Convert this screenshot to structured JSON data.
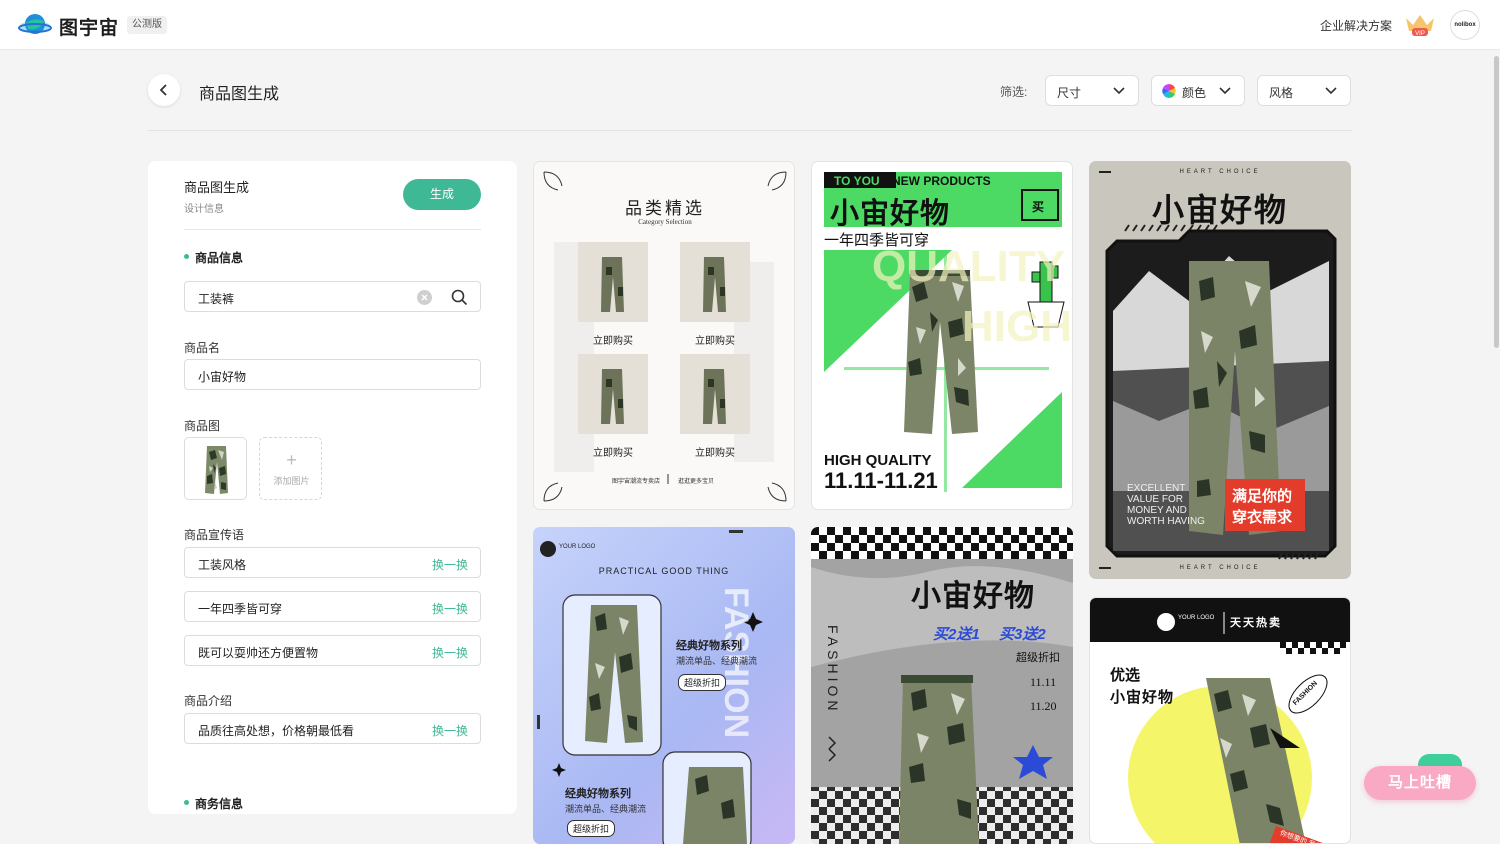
{
  "app": {
    "brand": "图宇宙",
    "badge": "公测版",
    "enterprise_link": "企业解决方案",
    "vip_label": "VIP",
    "avatar_text": "nolibox"
  },
  "header": {
    "title": "商品图生成",
    "filter_label": "筛选:",
    "filters": [
      {
        "label": "尺寸"
      },
      {
        "label": "颜色"
      },
      {
        "label": "风格"
      }
    ]
  },
  "panel": {
    "title": "商品图生成",
    "subtitle": "设计信息",
    "generate_label": "生成",
    "product_section": "商品信息",
    "search_value": "工装裤",
    "name_label": "商品名",
    "name_value": "小宙好物",
    "image_label": "商品图",
    "add_image_label": "添加图片",
    "slogan_label": "商品宣传语",
    "slogans": [
      "工装风格",
      "一年四季皆可穿",
      "既可以耍帅还方便置物"
    ],
    "intro_label": "商品介绍",
    "intro_value": "品质往高处想，价格朝最低看",
    "swap_label": "换一换",
    "business_section": "商务信息"
  },
  "cards": {
    "c1": {
      "title": "品类精选",
      "subtitle": "Category Selection",
      "buy": "立即购买",
      "footer_left": "图宇宙潮流专卖店",
      "footer_right": "逛逛更多宝贝"
    },
    "c2": {
      "tag1": "TO YOU",
      "tag2": "NEW PRODUCTS",
      "title": "小宙好物",
      "subtitle": "一年四季皆可穿",
      "buy_icon": "买",
      "bg_word1": "QUALITY",
      "bg_word2": "HIGH",
      "hq": "HIGH QUALITY",
      "date": "11.11-11.21"
    },
    "c3": {
      "top": "HEART CHOICE",
      "title": "小宙好物",
      "en1": "EXCELLENT",
      "en2": "VALUE FOR",
      "en3": "MONEY AND",
      "en4": "WORTH HAVING",
      "cn1": "满足你的",
      "cn2": "穿衣需求",
      "bottom": "HEART CHOICE"
    },
    "c4": {
      "logo": "YOUR LOGO",
      "header": "PRACTICAL GOOD THING",
      "series": "经典好物系列",
      "desc": "潮流单品、经典潮流",
      "tag": "超级折扣",
      "fashion": "FASHION"
    },
    "c5": {
      "title": "小宙好物",
      "promo1": "买2送1",
      "promo2": "买3送2",
      "discount": "超级折扣",
      "d1": "11.11",
      "d2": "11.20",
      "fashion": "FASHION"
    },
    "c6": {
      "logo": "YOUR LOGO",
      "hot": "天天热卖",
      "line1": "优选",
      "line2": "小宙好物",
      "fashion": "FASHION",
      "bottom": "你想要的 我都"
    }
  },
  "float_button": "马上吐槽",
  "colors": {
    "accent": "#3fb896",
    "green_poster": "#4cd964",
    "float": "#f9a9c4"
  }
}
